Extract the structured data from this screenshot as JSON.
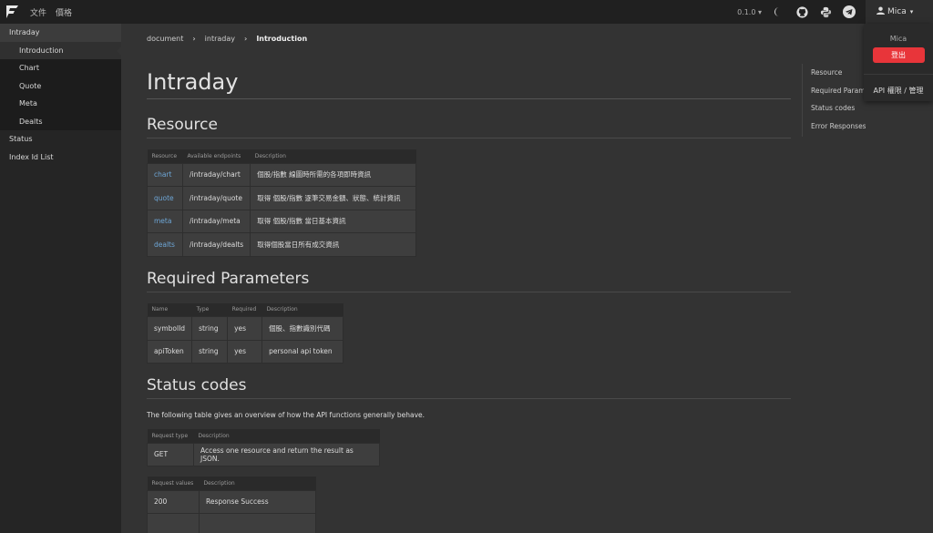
{
  "nav": {
    "links": [
      "文件",
      "價格"
    ],
    "version": "0.1.0",
    "user": "Mica"
  },
  "sidebar": {
    "items": [
      {
        "label": "Intraday"
      },
      {
        "label": "Introduction"
      },
      {
        "label": "Chart"
      },
      {
        "label": "Quote"
      },
      {
        "label": "Meta"
      },
      {
        "label": "Dealts"
      },
      {
        "label": "Status"
      },
      {
        "label": "Index Id List"
      }
    ]
  },
  "breadcrumb": {
    "items": [
      "document",
      "intraday",
      "Introduction"
    ]
  },
  "page": {
    "title": "Intraday",
    "resource": {
      "heading": "Resource",
      "headers": [
        "Resource",
        "Available endpoints",
        "Description"
      ],
      "rows": [
        [
          "chart",
          "/intraday/chart",
          "個股/指數 線圖時所需的各項即時資訊"
        ],
        [
          "quote",
          "/intraday/quote",
          "取得 個股/指數 逐筆交易金額、狀態、統計資訊"
        ],
        [
          "meta",
          "/intraday/meta",
          "取得 個股/指數 當日基本資訊"
        ],
        [
          "dealts",
          "/intraday/dealts",
          "取得個股當日所有成交資訊"
        ]
      ]
    },
    "params": {
      "heading": "Required Parameters",
      "headers": [
        "Name",
        "Type",
        "Required",
        "Description"
      ],
      "rows": [
        [
          "symbolId",
          "string",
          "yes",
          "個股、指數識別代碼"
        ],
        [
          "apiToken",
          "string",
          "yes",
          "personal api token"
        ]
      ]
    },
    "status": {
      "heading": "Status codes",
      "intro": "The following table gives an overview of how the API functions generally behave.",
      "type_headers": [
        "Request type",
        "Description"
      ],
      "type_rows": [
        [
          "GET",
          "Access one resource and return the result as JSON."
        ]
      ],
      "value_headers": [
        "Request values",
        "Description"
      ],
      "value_rows": [
        [
          "200",
          "Response Success"
        ],
        [
          "",
          ""
        ]
      ]
    }
  },
  "toc": {
    "items": [
      "Resource",
      "Required Parameters",
      "Status codes",
      "Error Responses"
    ]
  },
  "dropdown": {
    "name": "Mica",
    "logout": "登出",
    "api_manage": "API 權限 / 管理"
  }
}
